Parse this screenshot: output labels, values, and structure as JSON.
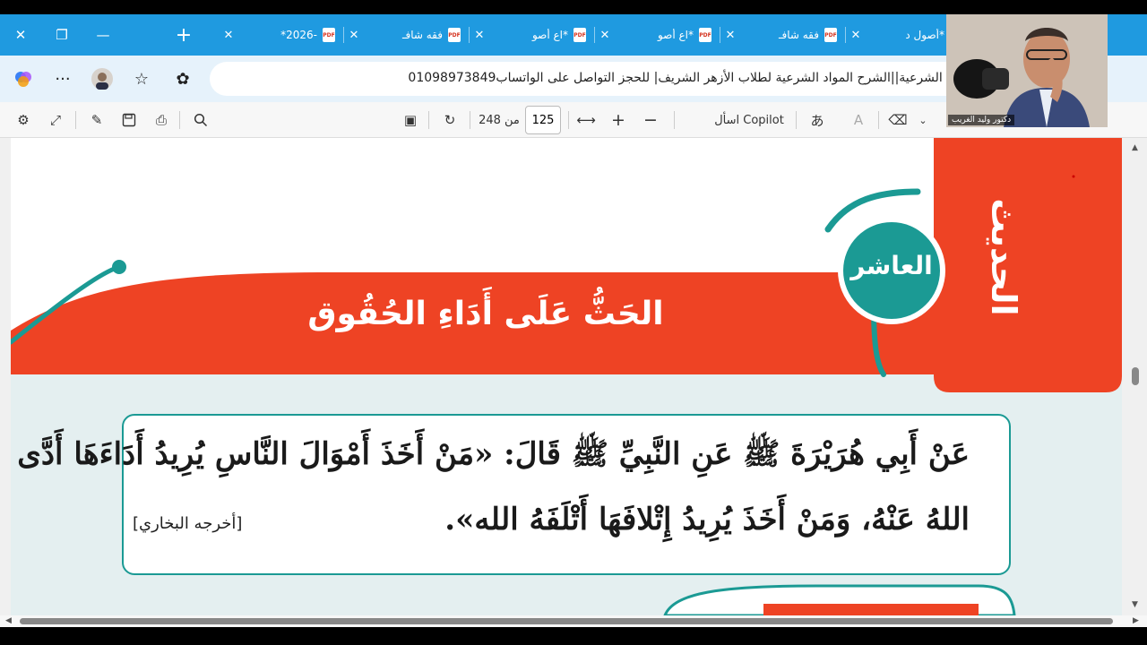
{
  "tabs": [
    {
      "title": "-2026*"
    },
    {
      "title": "فقه شافـ"
    },
    {
      "title": "*اع أصو"
    },
    {
      "title": "*اع أصو"
    },
    {
      "title": "فقه شافـ"
    },
    {
      "title": "*أصول د"
    }
  ],
  "address": {
    "url": "يوم الشرعية||الشرح المواد الشرعية لطلاب الأزهر الشريف| للحجز التواصل على الواتساب01098973849"
  },
  "pdf_toolbar": {
    "page_current": "125",
    "page_of": "من 248",
    "copilot_label": "اسأل Copilot"
  },
  "webcam": {
    "label": "دكتور وليد الغريب"
  },
  "document": {
    "badge": "العاشر",
    "vertical_word": "الحديث",
    "lesson_title": "الحَثُّ عَلَى أَدَاءِ الحُقُوق",
    "hadith_line1": "عَنْ أَبِي هُرَيْرَةَ ﷺ عَنِ النَّبِيِّ ﷺ قَالَ: «مَنْ أَخَذَ أَمْوَالَ النَّاسِ يُرِيدُ أَدَاءَهَا أَدَّى",
    "hadith_line2": "اللهُ عَنْهُ، وَمَنْ أَخَذَ يُرِيدُ إِتْلافَهَا أَتْلَفَهُ الله».",
    "source": "[أخرجه البخاري]"
  },
  "colors": {
    "orange": "#ee4324",
    "teal": "#1b9a94",
    "light_panel": "#e4eff0",
    "tab_blue": "#1f9ae0"
  }
}
